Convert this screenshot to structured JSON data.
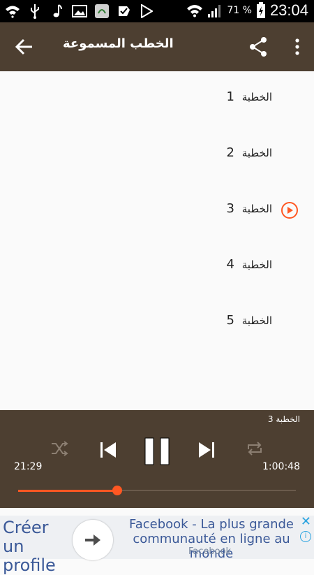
{
  "status_bar": {
    "battery_percent": "71 %",
    "time": "23:04",
    "icons": [
      "wifi-question-icon",
      "usb-icon",
      "music-note-icon",
      "image-icon",
      "app-icon",
      "check-icon",
      "play-store-icon"
    ]
  },
  "app_bar": {
    "title": "الخطب المسموعة",
    "icons": [
      "back-arrow-icon",
      "share-icon",
      "more-vert-icon"
    ]
  },
  "list": {
    "items": [
      {
        "label": "الخطبة",
        "num": "1"
      },
      {
        "label": "الخطبة",
        "num": "2"
      },
      {
        "label": "الخطبة",
        "num": "3",
        "playing": true
      },
      {
        "label": "الخطبة",
        "num": "4"
      },
      {
        "label": "الخطبة",
        "num": "5"
      }
    ]
  },
  "player": {
    "now_playing": "الخطبة 3",
    "elapsed": "21:29",
    "duration": "1:00:48",
    "progress_fraction": 0.357,
    "accent_color": "#ff5722",
    "bg_color": "#4d3f31"
  },
  "ad": {
    "cta": "Créer un profile",
    "headline": "Facebook - La plus grande communauté en ligne au monde",
    "source": "Facebook",
    "close_symbol": "✕",
    "info_symbol": "i"
  }
}
